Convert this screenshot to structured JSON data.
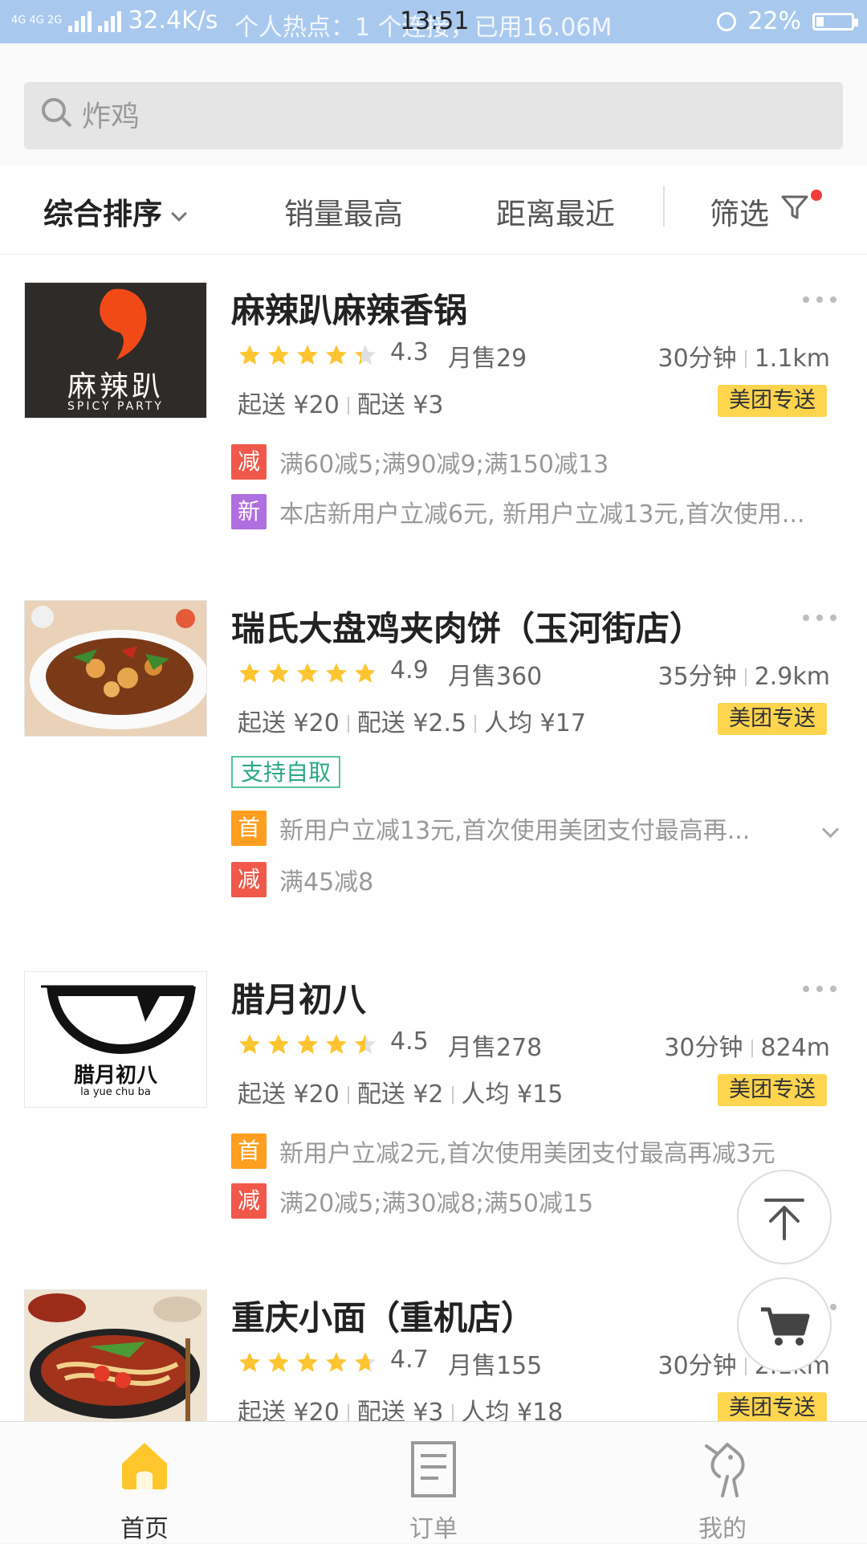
{
  "status_bar": {
    "network": "4G 4G 2G",
    "speed": "32.4K/s",
    "hotspot": "个人热点：1 个连接，已用16.06M",
    "time": "13:51",
    "battery": "22%",
    "battery_level": 0.22
  },
  "search": {
    "placeholder": "炸鸡"
  },
  "sort": {
    "comprehensive": "综合排序",
    "sales": "销量最高",
    "distance": "距离最近",
    "filter": "筛选"
  },
  "shops": [
    {
      "name": "麻辣趴麻辣香锅",
      "rating": "4.3",
      "rating_value": 4.3,
      "sales": "月售29",
      "time": "30分钟",
      "distance": "1.1km",
      "min_order": "起送 ¥20",
      "delivery": "配送 ¥3",
      "per_person": "",
      "badge": "美团专送",
      "logo_text": "麻辣趴",
      "logo_sub": "SPICY PARTY",
      "promos": [
        {
          "icon": "减",
          "text": "满60减5;满90减9;满150减13"
        },
        {
          "icon": "新",
          "text": "本店新用户立减6元, 新用户立减13元,首次使用..."
        }
      ]
    },
    {
      "name": "瑞氏大盘鸡夹肉饼（玉河街店）",
      "rating": "4.9",
      "rating_value": 4.9,
      "sales": "月售360",
      "time": "35分钟",
      "distance": "2.9km",
      "min_order": "起送 ¥20",
      "delivery": "配送 ¥2.5",
      "per_person": "人均 ¥17",
      "badge": "美团专送",
      "tag": "支持自取",
      "promos": [
        {
          "icon": "首",
          "text": "新用户立减13元,首次使用美团支付最高再..."
        },
        {
          "icon": "减",
          "text": "满45减8"
        }
      ]
    },
    {
      "name": "腊月初八",
      "rating": "4.5",
      "rating_value": 4.5,
      "sales": "月售278",
      "time": "30分钟",
      "distance": "824m",
      "min_order": "起送 ¥20",
      "delivery": "配送 ¥2",
      "per_person": "人均 ¥15",
      "badge": "美团专送",
      "logo_text": "腊月初八",
      "logo_sub": "la   yue   chu   ba",
      "promos": [
        {
          "icon": "首",
          "text": "新用户立减2元,首次使用美团支付最高再减3元"
        },
        {
          "icon": "减",
          "text": "满20减5;满30减8;满50减15"
        }
      ]
    },
    {
      "name": "重庆小面（重机店）",
      "rating": "4.7",
      "rating_value": 4.7,
      "sales": "月售155",
      "time": "30分钟",
      "distance": "2.1km",
      "min_order": "起送 ¥20",
      "delivery": "配送 ¥3",
      "per_person": "人均 ¥18",
      "badge": "美团专送"
    }
  ],
  "bottom_nav": {
    "home": "首页",
    "orders": "订单",
    "mine": "我的"
  },
  "colors": {
    "accent_yellow": "#ffd54f",
    "promo_red": "#f0584a",
    "promo_purple": "#b06fe0",
    "promo_orange": "#ff9e1f",
    "pickup_green": "#2ba685"
  }
}
